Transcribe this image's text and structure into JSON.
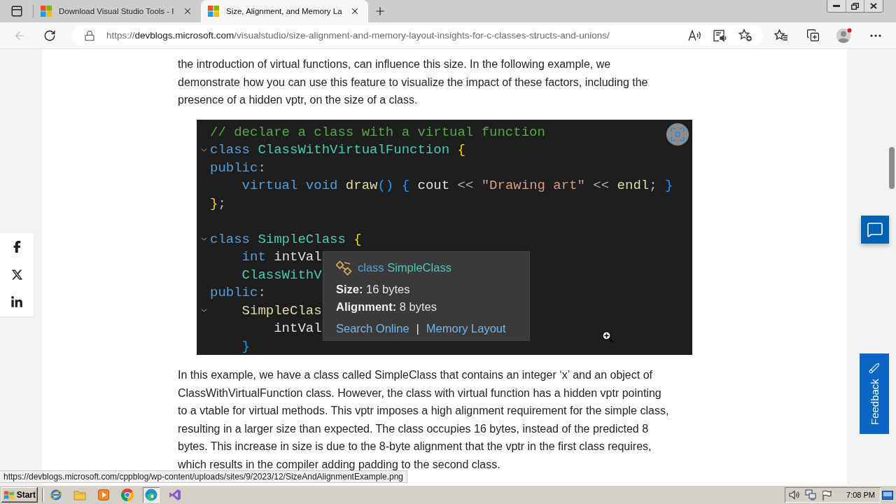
{
  "browser": {
    "tabs": [
      {
        "title": "Download Visual Studio Tools - I",
        "selected": false
      },
      {
        "title": "Size, Alignment, and Memory La",
        "selected": true
      }
    ],
    "back_button": {
      "disabled": true
    },
    "address": {
      "scheme": "https://",
      "host": "devblogs.microsoft.com",
      "path": "/visualstudio/size-alignment-and-memory-layout-insights-for-c-classes-structs-and-unions/"
    }
  },
  "article": {
    "content": [
      {
        "kind": "paragraph",
        "lines": [
          "the introduction of virtual functions, can influence this size. In the following example, we",
          "demonstrate how you can use this feature to visualize the impact of these factors, including the",
          "presence of a hidden vptr, on the size of a class."
        ]
      },
      {
        "kind": "code",
        "sections": [
          {
            "lines": [
              {
                "foldable": false,
                "tokens": [
                  {
                    "kind": "comment",
                    "text": "// declare a class with a virtual function"
                  }
                ]
              },
              {
                "foldable": true,
                "tokens": [
                  {
                    "kind": "keyword",
                    "text": "class"
                  },
                  {
                    "kind": "type",
                    "text": " ClassWithVirtualFunction"
                  },
                  {
                    "kind": "brace",
                    "text": " {"
                  }
                ]
              },
              {
                "foldable": false,
                "tokens": [
                  {
                    "kind": "keyword",
                    "text": "public"
                  },
                  {
                    "kind": "plain",
                    "text": ":"
                  }
                ]
              },
              {
                "foldable": false,
                "tokens": [
                  {
                    "kind": "keyword",
                    "text": "    virtual void"
                  },
                  {
                    "kind": "function",
                    "text": " draw"
                  },
                  {
                    "kind": "bracket",
                    "text": "()"
                  },
                  {
                    "kind": "bracket",
                    "text": " {"
                  },
                  {
                    "kind": "variable",
                    "text": " cout"
                  },
                  {
                    "kind": "plain",
                    "text": " <<"
                  },
                  {
                    "kind": "string",
                    "text": " \"Drawing art\""
                  },
                  {
                    "kind": "plain",
                    "text": " <<"
                  },
                  {
                    "kind": "function",
                    "text": " endl"
                  },
                  {
                    "kind": "plain",
                    "text": ";"
                  },
                  {
                    "kind": "bracket",
                    "text": " }"
                  }
                ]
              },
              {
                "foldable": false,
                "tokens": [
                  {
                    "kind": "brace",
                    "text": "}"
                  },
                  {
                    "kind": "plain",
                    "text": ";"
                  }
                ]
              }
            ]
          },
          {
            "lines": [
              {
                "foldable": true,
                "tokens": [
                  {
                    "kind": "keyword",
                    "text": "class"
                  },
                  {
                    "kind": "type",
                    "text": " SimpleClass"
                  },
                  {
                    "kind": "brace",
                    "text": " {"
                  }
                ]
              },
              {
                "foldable": false,
                "tokens": [
                  {
                    "kind": "keyword",
                    "text": "    int"
                  },
                  {
                    "kind": "variable",
                    "text": " intVal"
                  }
                ]
              },
              {
                "foldable": false,
                "tokens": [
                  {
                    "kind": "type",
                    "text": "    ClassWithV"
                  }
                ]
              },
              {
                "foldable": false,
                "tokens": [
                  {
                    "kind": "keyword",
                    "text": "public"
                  },
                  {
                    "kind": "plain",
                    "text": ":"
                  }
                ]
              },
              {
                "foldable": true,
                "tokens": [
                  {
                    "kind": "function",
                    "text": "    SimpleClas"
                  }
                ]
              },
              {
                "foldable": false,
                "tokens": [
                  {
                    "kind": "variable",
                    "text": "        intVal"
                  }
                ]
              },
              {
                "foldable": false,
                "tokens": [
                  {
                    "kind": "bracket",
                    "text": "    }"
                  }
                ]
              }
            ]
          }
        ],
        "tooltip": {
          "keyword": "class",
          "name": "SimpleClass",
          "facts": [
            "**Size:** 16 bytes",
            "**Alignment:** 8 bytes"
          ],
          "links": [
            "Search Online",
            "Memory Layout"
          ],
          "separator": "|"
        }
      },
      {
        "kind": "paragraph",
        "lines": [
          "In this example, we have a class called SimpleClass that contains an integer ‘x’ and an object of",
          "ClassWithVirtualFunction class. However, the class with virtual function has a hidden vptr pointing",
          "to a vtable for virtual methods. This vptr imposes a high alignment requirement for the simple class,",
          "resulting in a larger size than expected. The class occupies 16 bytes, instead of the predicted 8",
          "bytes. This increase in size is due to the 8-byte alignment that the vptr in the first class requires,",
          "which results in the compiler adding padding to the second class."
        ]
      }
    ]
  },
  "feedback": {
    "label": "Feedback"
  },
  "status_url": "https://devblogs.microsoft.com/cppblog/wp-content/uploads/sites/9/2023/12/SizeAndAlignmentExample.png",
  "taskbar": {
    "start": "Start",
    "apps": [
      {
        "kind": "ie",
        "selected": false
      },
      {
        "kind": "folder",
        "selected": false
      },
      {
        "kind": "player",
        "selected": false
      },
      {
        "kind": "chrome",
        "selected": false
      },
      {
        "kind": "edge",
        "selected": true
      },
      {
        "kind": "studio",
        "selected": false
      }
    ],
    "clock": "7:08 PM"
  }
}
